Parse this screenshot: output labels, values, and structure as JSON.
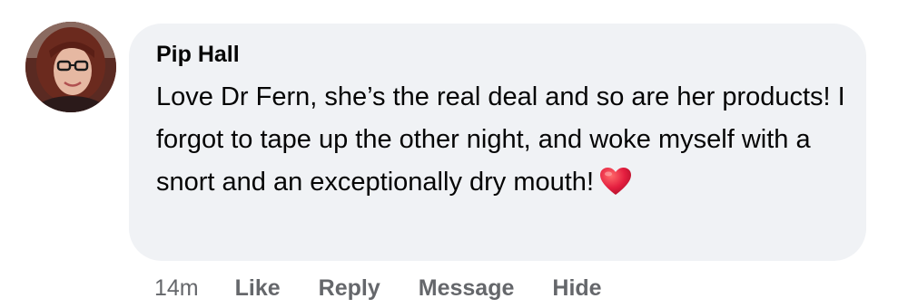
{
  "comment": {
    "author": "Pip Hall",
    "text": "Love Dr Fern, she’s the real deal and so are her products! I forgot to tape up the other night, and woke myself with a  snort and an exceptionally dry mouth!",
    "emoji": "red-heart-icon",
    "avatar": "profile-photo"
  },
  "actions": {
    "time": "14m",
    "like": "Like",
    "reply": "Reply",
    "message": "Message",
    "hide": "Hide"
  },
  "colors": {
    "bubble_bg": "#f0f2f5",
    "text": "#050505",
    "secondary_text": "#65676b",
    "heart": "#e41e3f"
  }
}
